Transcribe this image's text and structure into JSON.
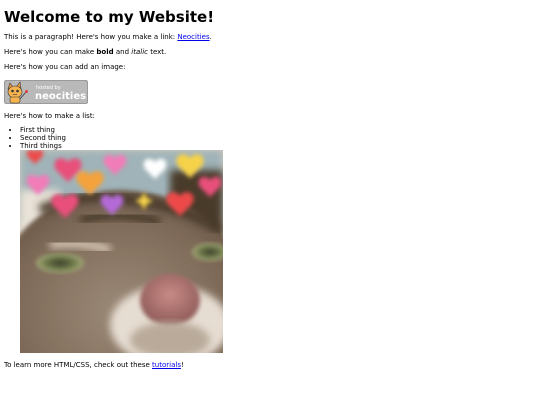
{
  "page": {
    "heading": "Welcome to my Website!",
    "paragraph1": {
      "before": "This is a paragraph! Here's how you make a link: ",
      "link_text": "Neocities",
      "after": "."
    },
    "paragraph2": {
      "before": "Here's how you can make ",
      "bold": "bold",
      "middle": " and ",
      "italic": "italic",
      "after": " text."
    },
    "paragraph3": "Here's how you can add an image:",
    "badge": {
      "small_text": "hosted by",
      "brand_text": "neocities"
    },
    "paragraph4": "Here's how to make a list:",
    "list_items": [
      "First thing",
      "Second thing",
      "Third things"
    ],
    "paragraph5": {
      "before": "To learn more HTML/CSS, check out these ",
      "link_text": "tutorials",
      "after": "!"
    }
  },
  "colors": {
    "link": "#0000ee",
    "badge_bg": "#b9b9b9",
    "badge_text": "#ffffff",
    "hearts": [
      "#e8507a",
      "#f4a23a",
      "#f6d24a",
      "#b36ad8",
      "#ee4a4a",
      "#f27cb8"
    ]
  }
}
